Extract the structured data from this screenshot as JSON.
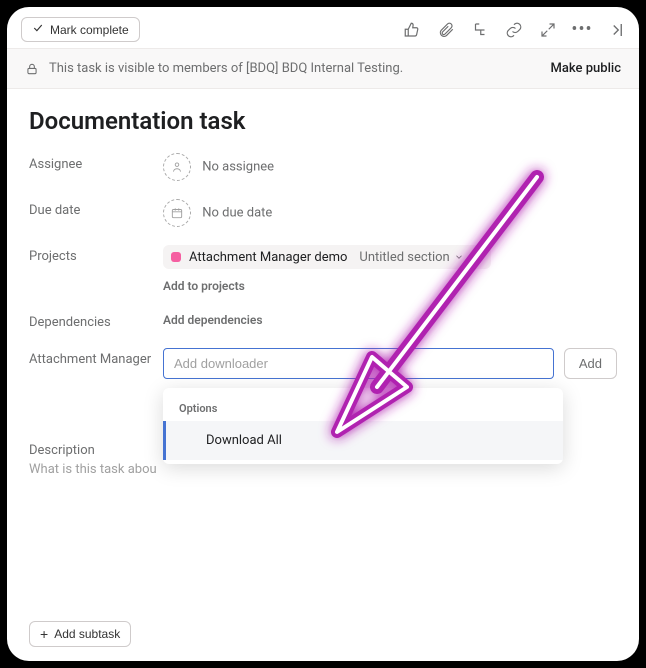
{
  "toolbar": {
    "mark_complete": "Mark complete"
  },
  "visibility": {
    "message": "This task is visible to members of [BDQ] BDQ Internal Testing.",
    "make_public": "Make public"
  },
  "task": {
    "title": "Documentation task"
  },
  "fields": {
    "assignee": {
      "label": "Assignee",
      "value": "No assignee"
    },
    "due_date": {
      "label": "Due date",
      "value": "No due date"
    },
    "projects": {
      "label": "Projects",
      "chip_name": "Attachment Manager demo",
      "chip_section": "Untitled section",
      "add_more": "Add to projects"
    },
    "dependencies": {
      "label": "Dependencies",
      "add": "Add dependencies"
    },
    "attachment_manager": {
      "label": "Attachment Manager",
      "placeholder": "Add downloader",
      "add_button": "Add",
      "dropdown_header": "Options",
      "dropdown_items": [
        "Download All"
      ]
    },
    "description": {
      "label": "Description",
      "placeholder": "What is this task abou"
    }
  },
  "bottom": {
    "add_subtask": "Add subtask"
  }
}
